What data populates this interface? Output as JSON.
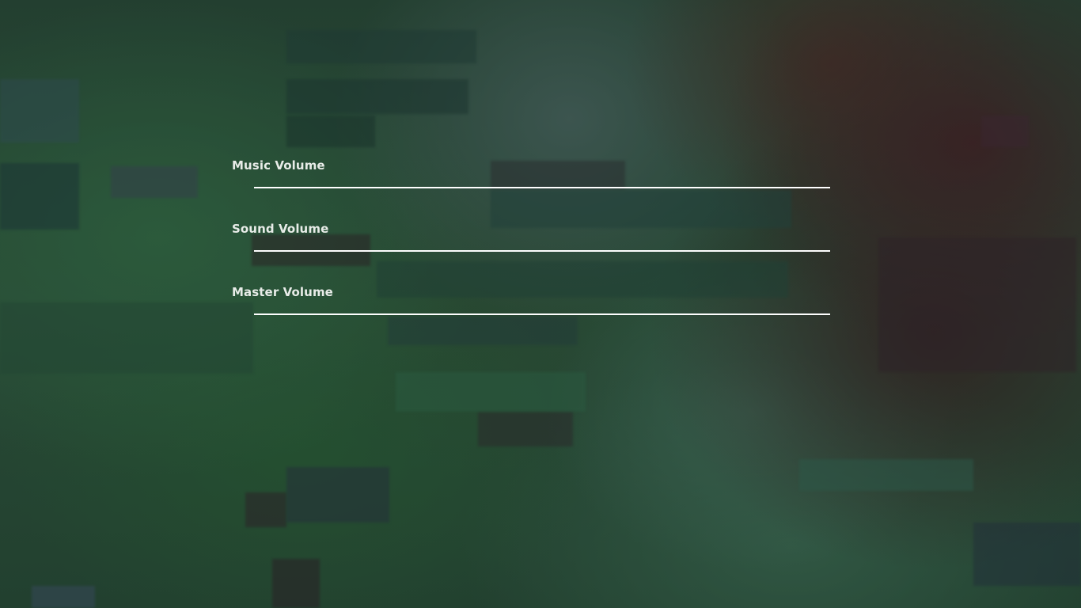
{
  "settings": {
    "sliders": [
      {
        "label": "Music Volume",
        "value": 1.0
      },
      {
        "label": "Sound Volume",
        "value": 1.0
      },
      {
        "label": "Master Volume",
        "value": 1.0
      }
    ]
  },
  "colors": {
    "label_text": "#e8ece8",
    "slider_track": "#e6ebe6"
  }
}
